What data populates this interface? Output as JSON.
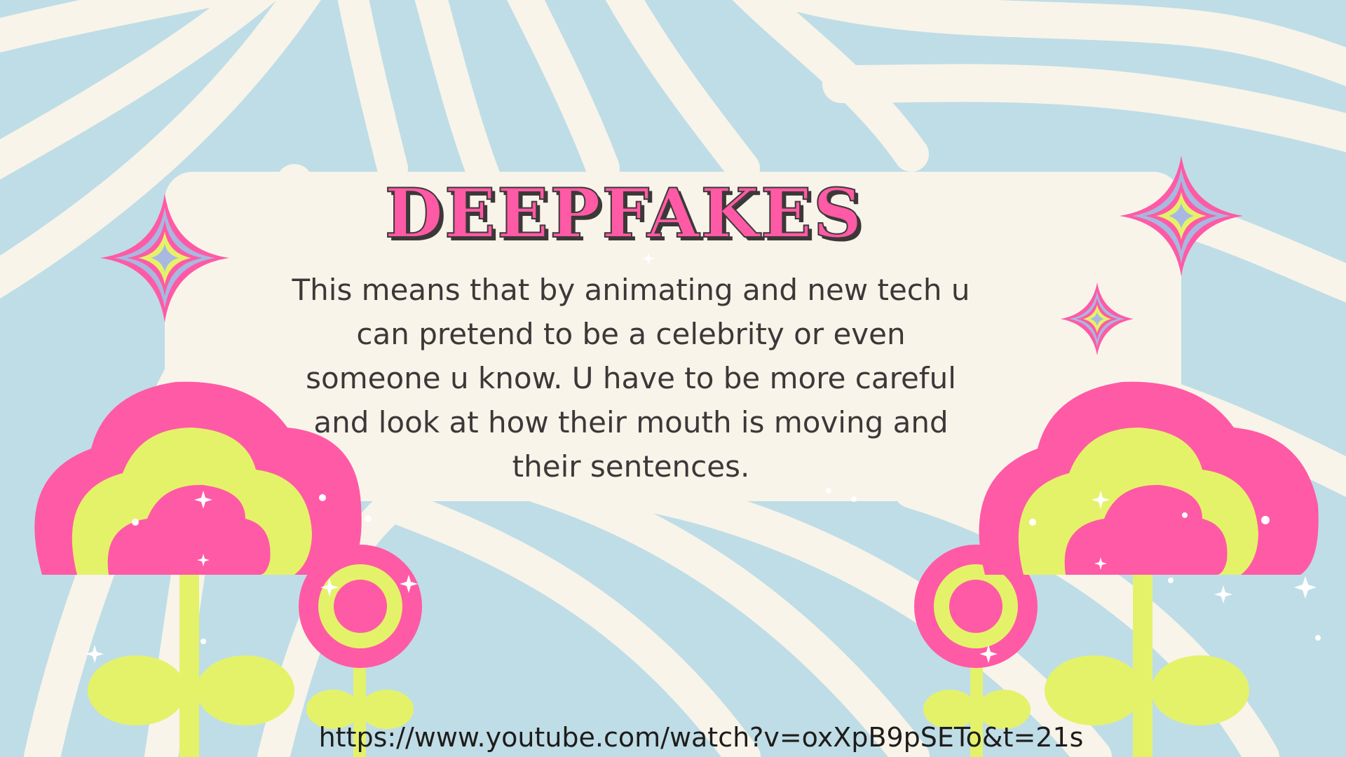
{
  "slide": {
    "title": "DEEPFAKES",
    "body_lines": [
      "This means that by animating and new tech u",
      "can pretend to be a celebrity or even",
      "someone u know. U have to be more careful",
      "and look at how their mouth is moving and",
      "their sentences."
    ],
    "source_url": "https://www.youtube.com/watch?v=oxXpB9pSETo&t=21s"
  },
  "colors": {
    "background_blue": "#bfdde6",
    "cream": "#f8f4ea",
    "pink": "#ff5aa5",
    "lime": "#e4f26a",
    "lavender": "#a8b8e0",
    "text_dark": "#3d3838"
  },
  "icons": [
    "sparkle-star-icon",
    "flower-icon",
    "twinkle-icon"
  ]
}
